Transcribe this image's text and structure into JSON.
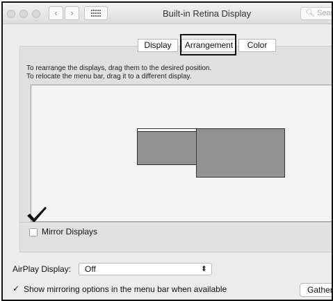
{
  "window": {
    "title": "Built-in Retina Display"
  },
  "toolbar": {
    "back_icon": "chevron-left",
    "forward_icon": "chevron-right",
    "grid_icon": "grid-icon",
    "search_placeholder": "Search"
  },
  "tabs": [
    {
      "label": "Display"
    },
    {
      "label": "Arrangement",
      "selected": true
    },
    {
      "label": "Color"
    }
  ],
  "instructions": {
    "line1": "To rearrange the displays, drag them to the desired position.",
    "line2": "To relocate the menu bar, drag it to a different display."
  },
  "displays": [
    {
      "label": "",
      "has_menu_bar": true
    },
    {
      "label": "",
      "has_menu_bar": false
    }
  ],
  "mirror": {
    "label": "Mirror Displays",
    "checked": false
  },
  "airplay": {
    "label": "AirPlay Display:",
    "value": "Off"
  },
  "show_mirroring": {
    "label": "Show mirroring options in the menu bar when available",
    "checked": true
  },
  "gather_button": {
    "label": "Gather Windows"
  },
  "colors": {
    "display_fill": "#929292",
    "window_bg": "#ececec",
    "annotation": "#111111"
  }
}
